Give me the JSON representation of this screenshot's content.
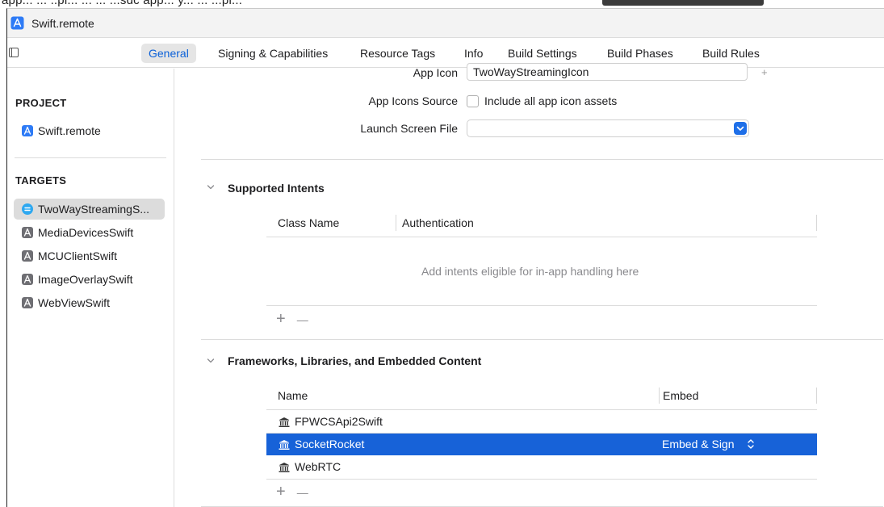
{
  "top_strip": {
    "text": "app... ... ..pi... ... ... ...sdc app... y... ... ...pi..."
  },
  "window": {
    "title": "Swift.remote"
  },
  "tabs": [
    {
      "label": "General",
      "active": true
    },
    {
      "label": "Signing & Capabilities",
      "active": false
    },
    {
      "label": "Resource Tags",
      "active": false
    },
    {
      "label": "Info",
      "active": false
    },
    {
      "label": "Build Settings",
      "active": false
    },
    {
      "label": "Build Phases",
      "active": false
    },
    {
      "label": "Build Rules",
      "active": false
    }
  ],
  "sidebar": {
    "project_heading": "PROJECT",
    "project_item": "Swift.remote",
    "targets_heading": "TARGETS",
    "targets": [
      {
        "label": "TwoWayStreamingS...",
        "selected": true,
        "icon": "streaming-app-icon"
      },
      {
        "label": "MediaDevicesSwift",
        "selected": false,
        "icon": "app-target-icon"
      },
      {
        "label": "MCUClientSwift",
        "selected": false,
        "icon": "app-target-icon"
      },
      {
        "label": "ImageOverlaySwift",
        "selected": false,
        "icon": "app-target-icon"
      },
      {
        "label": "WebViewSwift",
        "selected": false,
        "icon": "app-target-icon"
      }
    ]
  },
  "app_icons": {
    "app_icon_label": "App Icon",
    "app_icon_value": "TwoWayStreamingIcon",
    "add_symbol": "+",
    "app_icons_source_label": "App Icons Source",
    "include_all_label": "Include all app icon assets",
    "include_all_checked": false,
    "launch_screen_label": "Launch Screen File",
    "launch_screen_value": ""
  },
  "intents": {
    "title": "Supported Intents",
    "columns": [
      "Class Name",
      "Authentication"
    ],
    "empty_message": "Add intents eligible for in-app handling here",
    "add_symbol": "+",
    "remove_symbol": "—"
  },
  "frameworks": {
    "title": "Frameworks, Libraries, and Embedded Content",
    "columns": [
      "Name",
      "Embed"
    ],
    "rows": [
      {
        "name": "FPWCSApi2Swift",
        "embed": "",
        "selected": false
      },
      {
        "name": "SocketRocket",
        "embed": "Embed & Sign",
        "selected": true
      },
      {
        "name": "WebRTC",
        "embed": "",
        "selected": false
      }
    ],
    "add_symbol": "+",
    "remove_symbol": "—"
  },
  "colors": {
    "accent": "#1762d8",
    "active_tab_text": "#0a60d8",
    "sidebar_selection": "#dcdcdc"
  }
}
